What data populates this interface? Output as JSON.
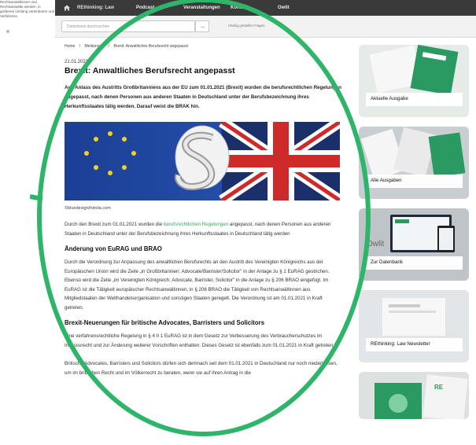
{
  "left_snippet": "Rechtsanwältinnen und Rechtsanwälte werden, in größeren Umfang vereinbaren und Verfahrens",
  "topbar": {
    "brand": "REthinking: Law",
    "nav": [
      "Podcast",
      "Veranstaltungen",
      "Kontakt",
      "Owlit"
    ]
  },
  "search": {
    "placeholder": "Datenbank durchsuchen",
    "hint": "Häufig gestellte Fragen"
  },
  "breadcrumb": {
    "home": "Home",
    "sep": "/",
    "section": "Meldungen",
    "current": "Brexit: Anwaltliches Berufsrecht angepasst"
  },
  "article": {
    "date": "21.01.2021",
    "title": "Brexit: Anwaltliches Berufsrecht angepasst",
    "lead": "Aus Anlass des Austritts Großbritanniens aus der EU zum 01.01.2021 (Brexit) wurden die berufsrechtlichen Regelungen angepasst, nach denen Personen aus anderen Staaten in Deutschland unter der Berufsbezeichnung ihres Herkunftsstaates tätig werden. Darauf weist die BRAK hin.",
    "image_caption": "©bluedesign/fotolia.com",
    "p1_before": "Durch den Brexit zum 01.01.2021 wurden die ",
    "p1_link": "berufsrechtlichen Regelungen",
    "p1_after": " angepasst, nach denen Personen aus anderen Staaten in Deutschland unter der Berufsbezeichnung ihres Herkunftsstaates in Deutschland tätig werden",
    "h2_1": "Änderung von EuRAG und BRAO",
    "p2": "Durch die Verordnung zur Anpassung des anwaltlichen Berufsrechts an den Austritt des Vereinigten Königreichs aus der Europäischen Union wird die Zeile „in Großbritannien: Advocate/Barrister/Solicitor\" in der Anlage zu § 1 EuRAG gestrichen. Ebenso wird die Zeile „im Vereinigten Königreich: Advocate, Barrister, Solicitor\" in die Anlage zu § 206 BRAO eingefügt. Im EuRAG ist die Tätigkeit europäischer Rechtsanwältinnen, in § 206 BRAO die Tätigkeit von Rechtsanwältinnen aus Mitgliedstaaten der Welthandelsorganisation und sonstigen Staaten geregelt. Die Verordnung ist am 01.01.2021 in Kraft getreten.",
    "h2_2": "Brexit-Neuerungen für britische Advocates, Barristers und Solicitors",
    "p3": "Eine verfahrensrechtliche Regelung in § 4 II 1 EuRAG ist in dem Gesetz zur Verbesserung des Verbraucherschutzes im Inkassorecht und zur Änderung weiterer Vorschriften enthalten. Dieses Gesetz ist ebenfalls zum 01.01.2021 in Kraft getreten.",
    "p4": "Britische Advocates, Barristers und Solicitors dürfen sich demnach seit dem 01.01.2021 in Deutschland nur noch niederlassen, um im britischen Recht und im Völkerrecht zu beraten, wenn sie auf ihren Antrag in die"
  },
  "sidebar": [
    {
      "label": "Aktuelle Ausgabe"
    },
    {
      "label": "Alle Ausgaben"
    },
    {
      "label": "Zur Datenbank"
    },
    {
      "label": "REthinking: Law Newsletter"
    },
    {
      "label": ""
    }
  ],
  "colors": {
    "accent_green": "#2fb56a",
    "link_green": "#3aa858",
    "topbar": "#3a3a3a",
    "search_arrow": "#e8703a"
  }
}
